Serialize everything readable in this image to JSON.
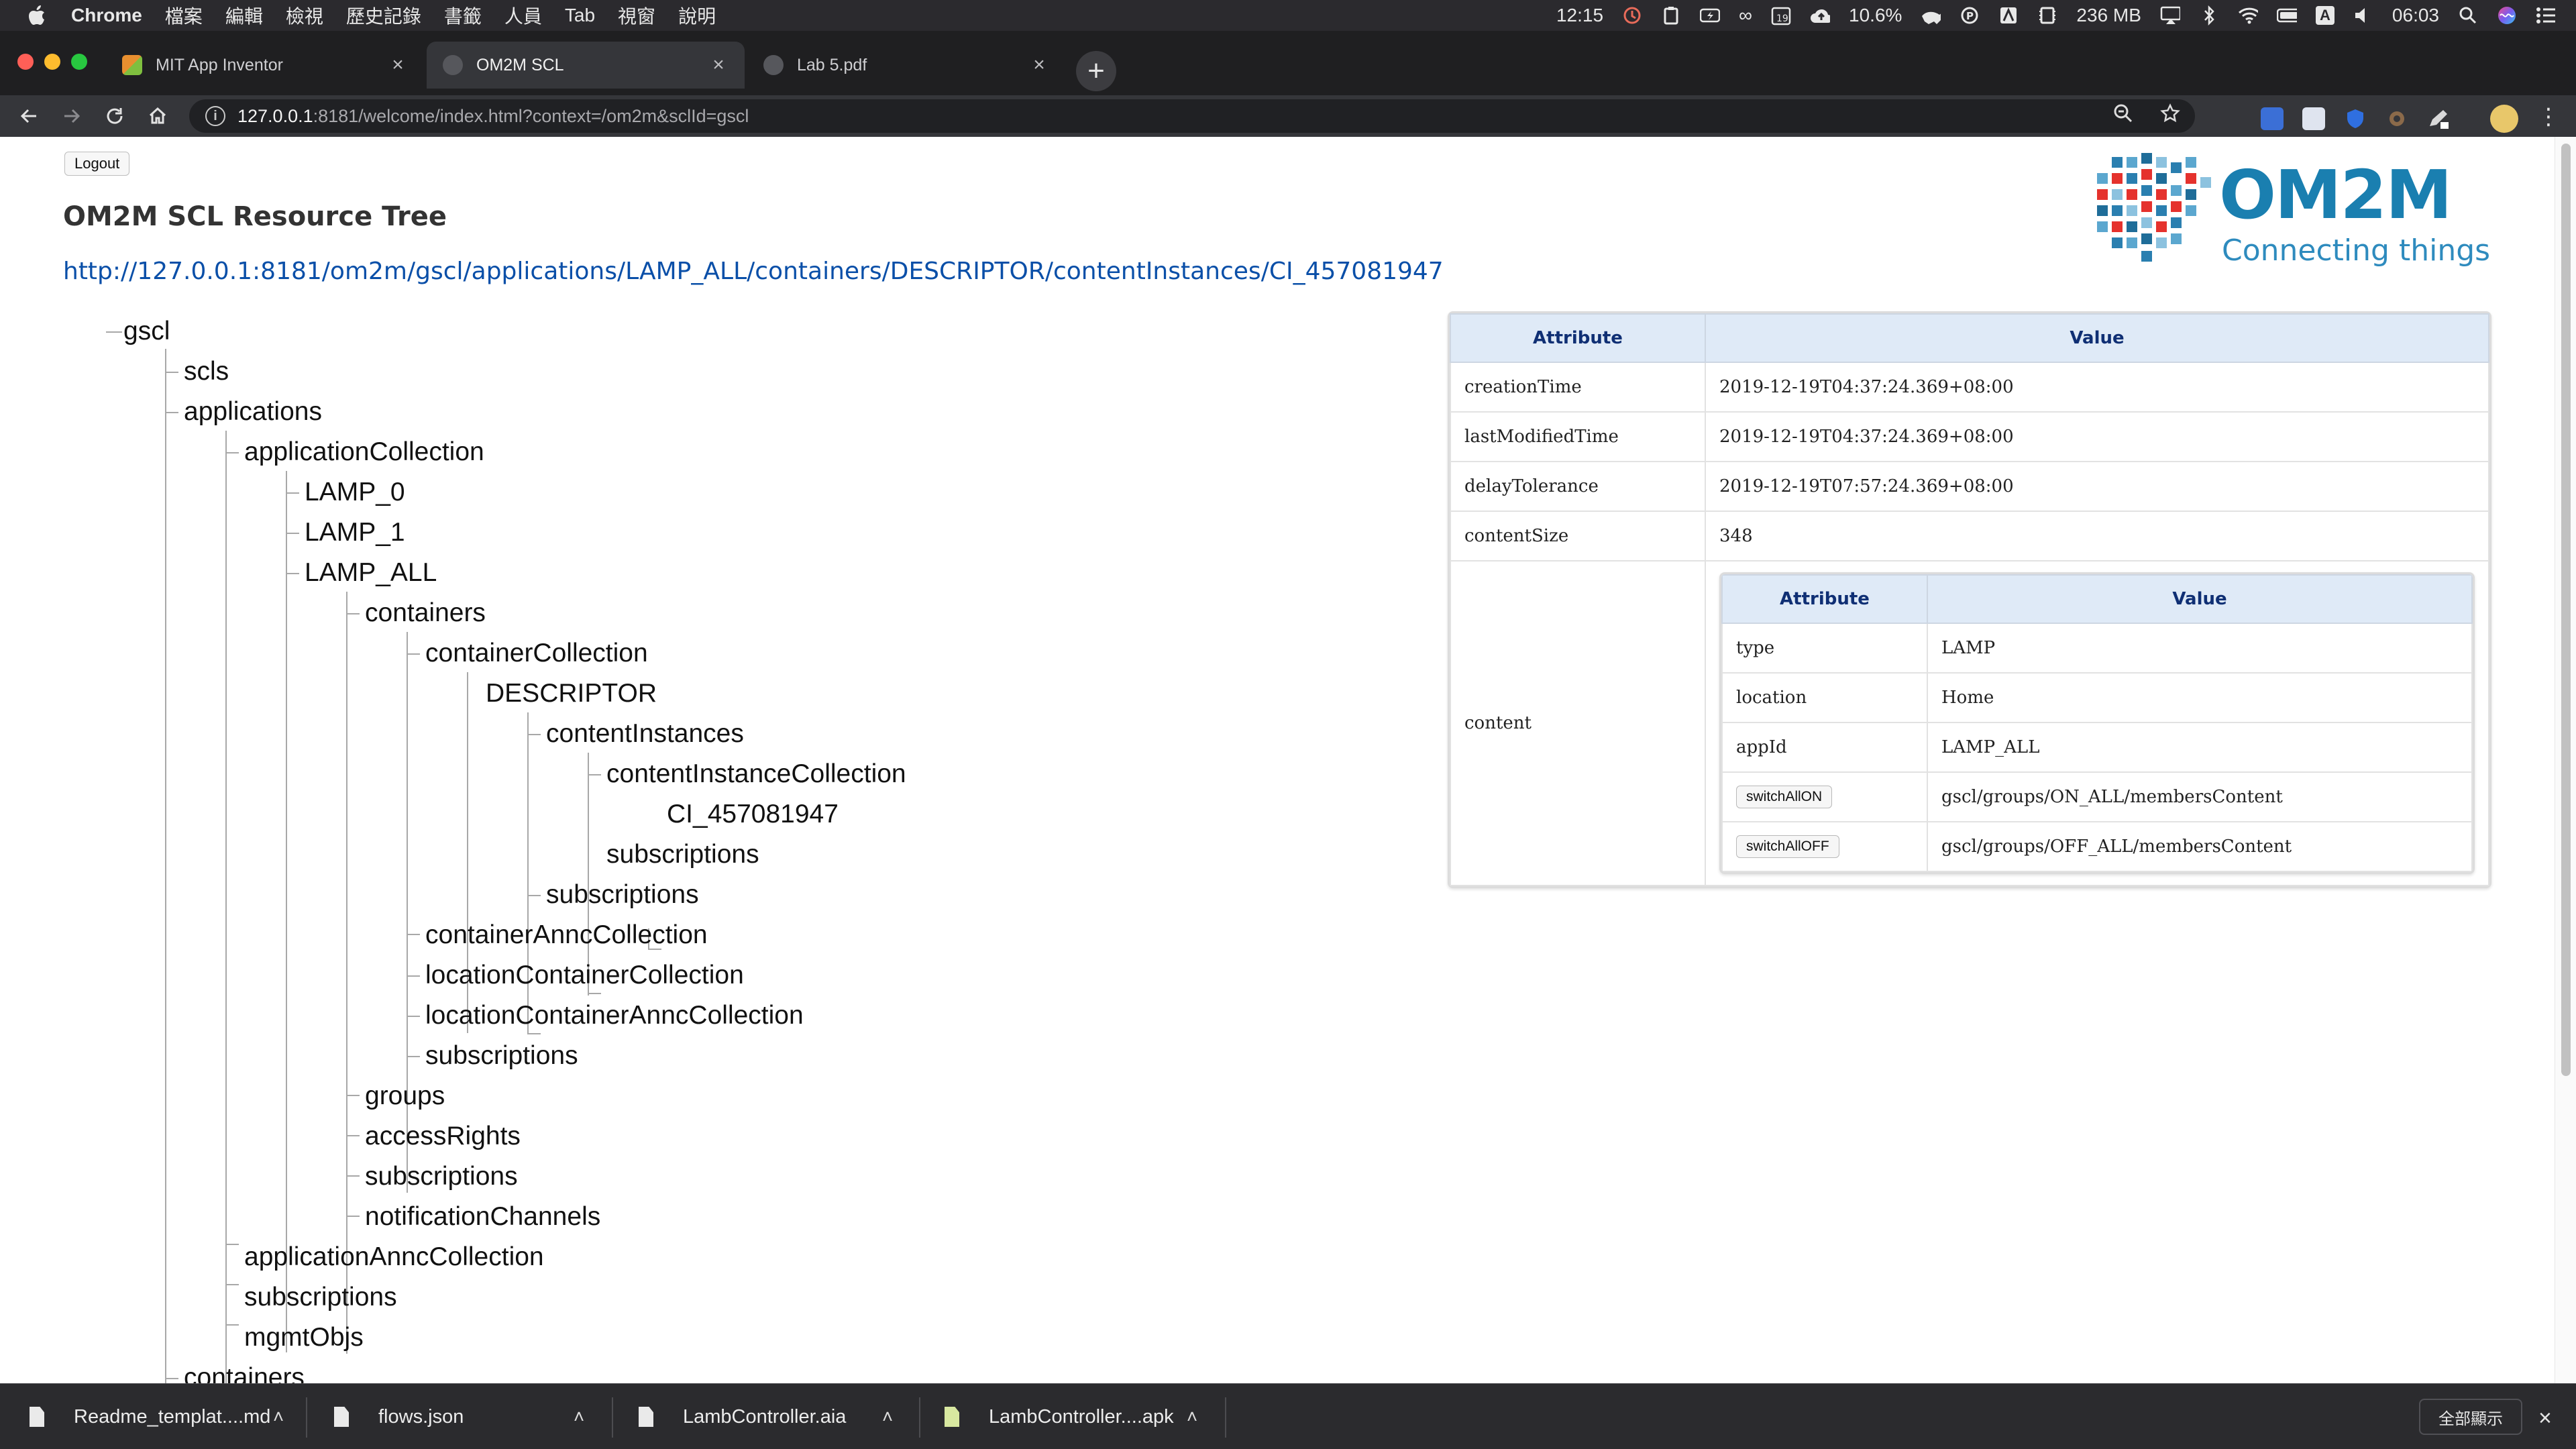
{
  "menubar": {
    "app": "Chrome",
    "items": [
      "檔案",
      "編輯",
      "檢視",
      "歷史記錄",
      "書籤",
      "人員",
      "Tab",
      "視窗",
      "說明"
    ],
    "status": {
      "timer": "12:15",
      "battery_infinity": "∞",
      "calendar_day": "19",
      "cpu": "10.6%",
      "memory": "236 MB",
      "input_letter": "A",
      "clock": "06:03"
    }
  },
  "tabs": [
    {
      "title": "MIT App Inventor",
      "active": false
    },
    {
      "title": "OM2M SCL",
      "active": true
    },
    {
      "title": "Lab 5.pdf",
      "active": false
    }
  ],
  "address": {
    "host": "127.0.0.1",
    "rest": ":8181/welcome/index.html?context=/om2m&sclId=gscl"
  },
  "page": {
    "logout_label": "Logout",
    "title": "OM2M SCL Resource Tree",
    "resource_url": "http://127.0.0.1:8181/om2m/gscl/applications/LAMP_ALL/containers/DESCRIPTOR/contentInstances/CI_457081947",
    "logo": {
      "brand": "OM2M",
      "tagline": "Connecting things"
    }
  },
  "tree": {
    "gscl": "gscl",
    "scls": "scls",
    "applications": "applications",
    "applicationCollection": "applicationCollection",
    "lamp0": "LAMP_0",
    "lamp1": "LAMP_1",
    "lampAll": "LAMP_ALL",
    "containers": "containers",
    "containerCollection": "containerCollection",
    "descriptor": "DESCRIPTOR",
    "contentInstances": "contentInstances",
    "contentInstanceCollection": "contentInstanceCollection",
    "ci": "CI_457081947",
    "subscriptions_ci": "subscriptions",
    "subscriptions_desc": "subscriptions",
    "containerAnncCollection": "containerAnncCollection",
    "locationContainerCollection": "locationContainerCollection",
    "locationContainerAnncCollection": "locationContainerAnncCollection",
    "subscriptions_cont": "subscriptions",
    "groups": "groups",
    "accessRights": "accessRights",
    "subscriptions_lamp": "subscriptions",
    "notificationChannels": "notificationChannels",
    "applicationAnncCollection": "applicationAnncCollection",
    "subscriptions_apps": "subscriptions",
    "mgmtObjs": "mgmtObjs",
    "containers_root": "containers"
  },
  "attributes": {
    "header_attribute": "Attribute",
    "header_value": "Value",
    "creationTime_key": "creationTime",
    "creationTime": "2019-12-19T04:37:24.369+08:00",
    "lastModifiedTime_key": "lastModifiedTime",
    "lastModifiedTime": "2019-12-19T04:37:24.369+08:00",
    "delayTolerance_key": "delayTolerance",
    "delayTolerance": "2019-12-19T07:57:24.369+08:00",
    "contentSize_key": "contentSize",
    "contentSize": "348",
    "content_key": "content",
    "content": {
      "type_key": "type",
      "type": "LAMP",
      "location_key": "location",
      "location": "Home",
      "appId_key": "appId",
      "appId": "LAMP_ALL",
      "switchAllON_label": "switchAllON",
      "switchAllON": "gscl/groups/ON_ALL/membersContent",
      "switchAllOFF_label": "switchAllOFF",
      "switchAllOFF": "gscl/groups/OFF_ALL/membersContent"
    }
  },
  "downloads": {
    "items": [
      "Readme_templat....md",
      "flows.json",
      "LambController.aia",
      "LambController....apk"
    ],
    "show_all": "全部顯示"
  }
}
